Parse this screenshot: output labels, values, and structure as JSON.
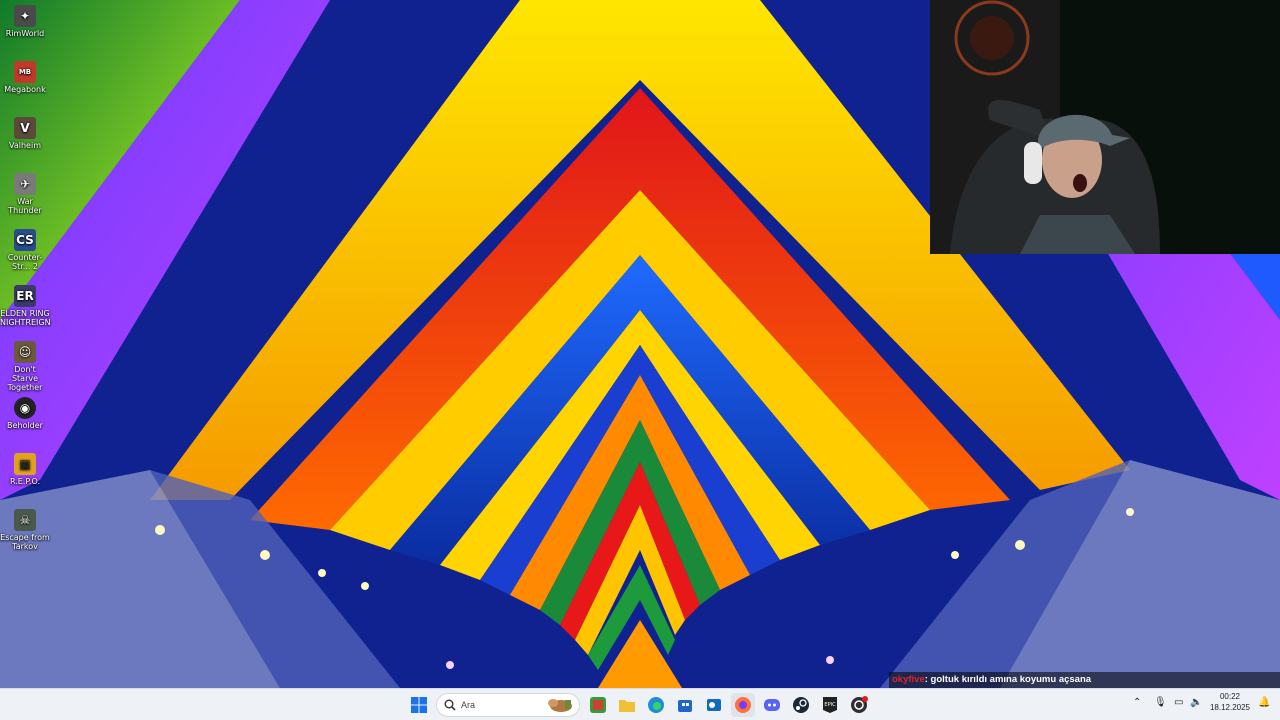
{
  "desktop": {
    "icons": [
      {
        "label": "RimWorld",
        "icon": "rimworld-icon",
        "color": "#4a4a4a"
      },
      {
        "label": "Megabonk",
        "icon": "megabonk-icon",
        "color": "#c0392b"
      },
      {
        "label": "Valheim",
        "icon": "valheim-icon",
        "color": "#5b4a3a"
      },
      {
        "label": "War Thunder",
        "icon": "war-thunder-icon",
        "color": "#7a7a7a"
      },
      {
        "label": "Counter-Str... 2",
        "icon": "counter-strike-icon",
        "color": "#2b4c8c"
      },
      {
        "label": "ELDEN RING NIGHTREIGN",
        "icon": "elden-ring-icon",
        "color": "#3a3a6a"
      },
      {
        "label": "Don't Starve Together",
        "icon": "dont-starve-icon",
        "color": "#6b5a3a"
      },
      {
        "label": "Beholder",
        "icon": "beholder-icon",
        "color": "#222222"
      },
      {
        "label": "R.E.P.O.",
        "icon": "repo-icon",
        "color": "#e0a020"
      },
      {
        "label": "Escape from Tarkov",
        "icon": "tarkov-icon",
        "color": "#4a5a4a"
      }
    ]
  },
  "chat": {
    "username": "okyfive",
    "message": ": goltuk kırıldı amına koyumu açsana"
  },
  "taskbar": {
    "search_placeholder": "Ara",
    "pinned": [
      {
        "name": "start-button",
        "icon": "windows-icon",
        "color": "#1a73e8"
      },
      {
        "name": "pinned-xbox-app",
        "icon": "xbox-icon",
        "color": "#3a9a3a"
      },
      {
        "name": "pinned-file-explorer",
        "icon": "folder-icon",
        "color": "#f2c037"
      },
      {
        "name": "pinned-edge",
        "icon": "edge-icon",
        "color": "#1a8fd6"
      },
      {
        "name": "pinned-store",
        "icon": "store-icon",
        "color": "#1e66c9"
      },
      {
        "name": "pinned-outlook",
        "icon": "outlook-icon",
        "color": "#0f6cbd"
      },
      {
        "name": "pinned-firefox",
        "icon": "firefox-icon",
        "color": "#ff7139"
      },
      {
        "name": "pinned-discord",
        "icon": "discord-icon",
        "color": "#5865f2"
      },
      {
        "name": "pinned-steam",
        "icon": "steam-icon",
        "color": "#1b2838"
      },
      {
        "name": "pinned-epic-games",
        "icon": "epic-games-icon",
        "color": "#222222"
      },
      {
        "name": "pinned-obs",
        "icon": "obs-icon",
        "color": "#302e31"
      }
    ],
    "clock": {
      "time": "00:22",
      "date": "18.12.2025"
    }
  }
}
